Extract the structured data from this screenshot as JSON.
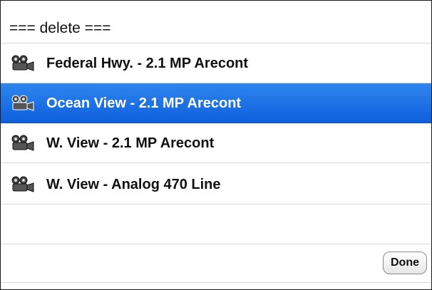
{
  "header": {
    "title": "=== delete ==="
  },
  "list": {
    "items": [
      {
        "label": "Federal Hwy. - 2.1 MP Arecont",
        "icon": "camera-icon",
        "selected": false
      },
      {
        "label": "Ocean View - 2.1 MP Arecont",
        "icon": "camera-icon",
        "selected": true
      },
      {
        "label": "W. View - 2.1 MP Arecont",
        "icon": "camera-icon",
        "selected": false
      },
      {
        "label": "W. View - Analog 470 Line",
        "icon": "camera-icon",
        "selected": false
      }
    ]
  },
  "toolbar": {
    "done_label": "Done"
  },
  "colors": {
    "selection": "#1a6fe8",
    "divider": "#d8d8d8",
    "text": "#111111"
  }
}
